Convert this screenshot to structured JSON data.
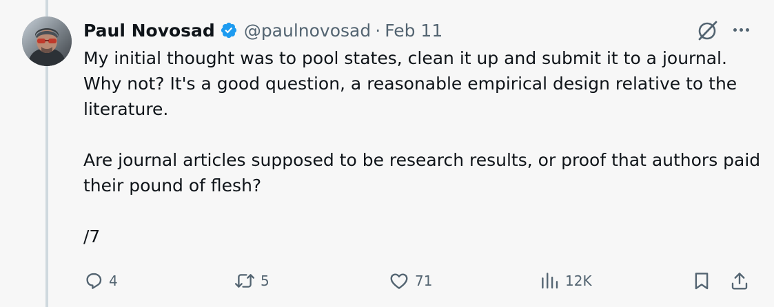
{
  "tweet": {
    "author_name": "Paul Novosad",
    "handle": "@paulnovosad",
    "separator": "·",
    "date": "Feb 11",
    "verified": true,
    "body": {
      "paragraph_1": "My initial thought was to pool states, clean it up and submit it to a journal. Why not? It's a good question, a reasonable empirical design relative to the literature.",
      "paragraph_2": "Are journal articles supposed to be research results, or proof that authors paid their pound of flesh?",
      "paragraph_3": "/7"
    }
  },
  "actions": {
    "replies": "4",
    "reposts": "5",
    "likes": "71",
    "views": "12K"
  },
  "icons": {
    "verified": "verified-badge-icon",
    "grok": "grok-icon",
    "more": "more-icon",
    "reply": "reply-icon",
    "repost": "repost-icon",
    "like": "like-icon",
    "views": "views-icon",
    "bookmark": "bookmark-icon",
    "share": "share-icon"
  },
  "colors": {
    "background": "#f7f7f7",
    "text_primary": "#0f1419",
    "text_secondary": "#536471",
    "verified_blue": "#1d9bf0",
    "thread_line": "#cfd9de"
  }
}
